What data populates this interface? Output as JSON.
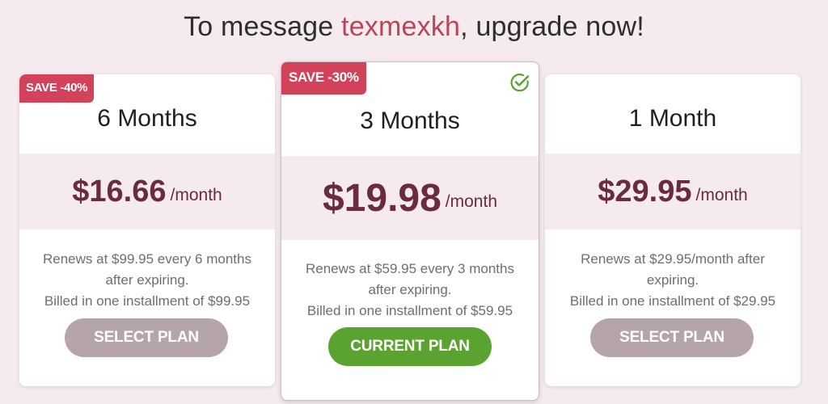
{
  "header": {
    "prefix": "To message ",
    "username": "texmexkh",
    "suffix": ", upgrade now!"
  },
  "plans": [
    {
      "badge": "SAVE -40%",
      "title": "6 Months",
      "price": "$16.66",
      "period": "/month",
      "details": [
        "Renews at $99.95 every 6 months",
        "after expiring.",
        "Billed in one installment of $99.95"
      ],
      "button_label": "SELECT PLAN"
    },
    {
      "badge": "SAVE -30%",
      "title": "3 Months",
      "price": "$19.98",
      "period": "/month",
      "details": [
        "Renews at $59.95 every 3 months",
        "after expiring.",
        "Billed in one installment of $59.95"
      ],
      "button_label": "CURRENT PLAN",
      "selected_icon": "check-circle-icon"
    },
    {
      "title": "1 Month",
      "price": "$29.95",
      "period": "/month",
      "details": [
        "Renews at $29.95/month after",
        "expiring.",
        "Billed in one installment of $29.95"
      ],
      "button_label": "SELECT PLAN"
    }
  ],
  "colors": {
    "page_background": "#f5eaee",
    "accent": "#b8465a",
    "badge": "#d2425a",
    "price": "#6a2a40",
    "select_button": "#b6a4ab",
    "current_button": "#5aa331",
    "check": "#5aa331"
  }
}
